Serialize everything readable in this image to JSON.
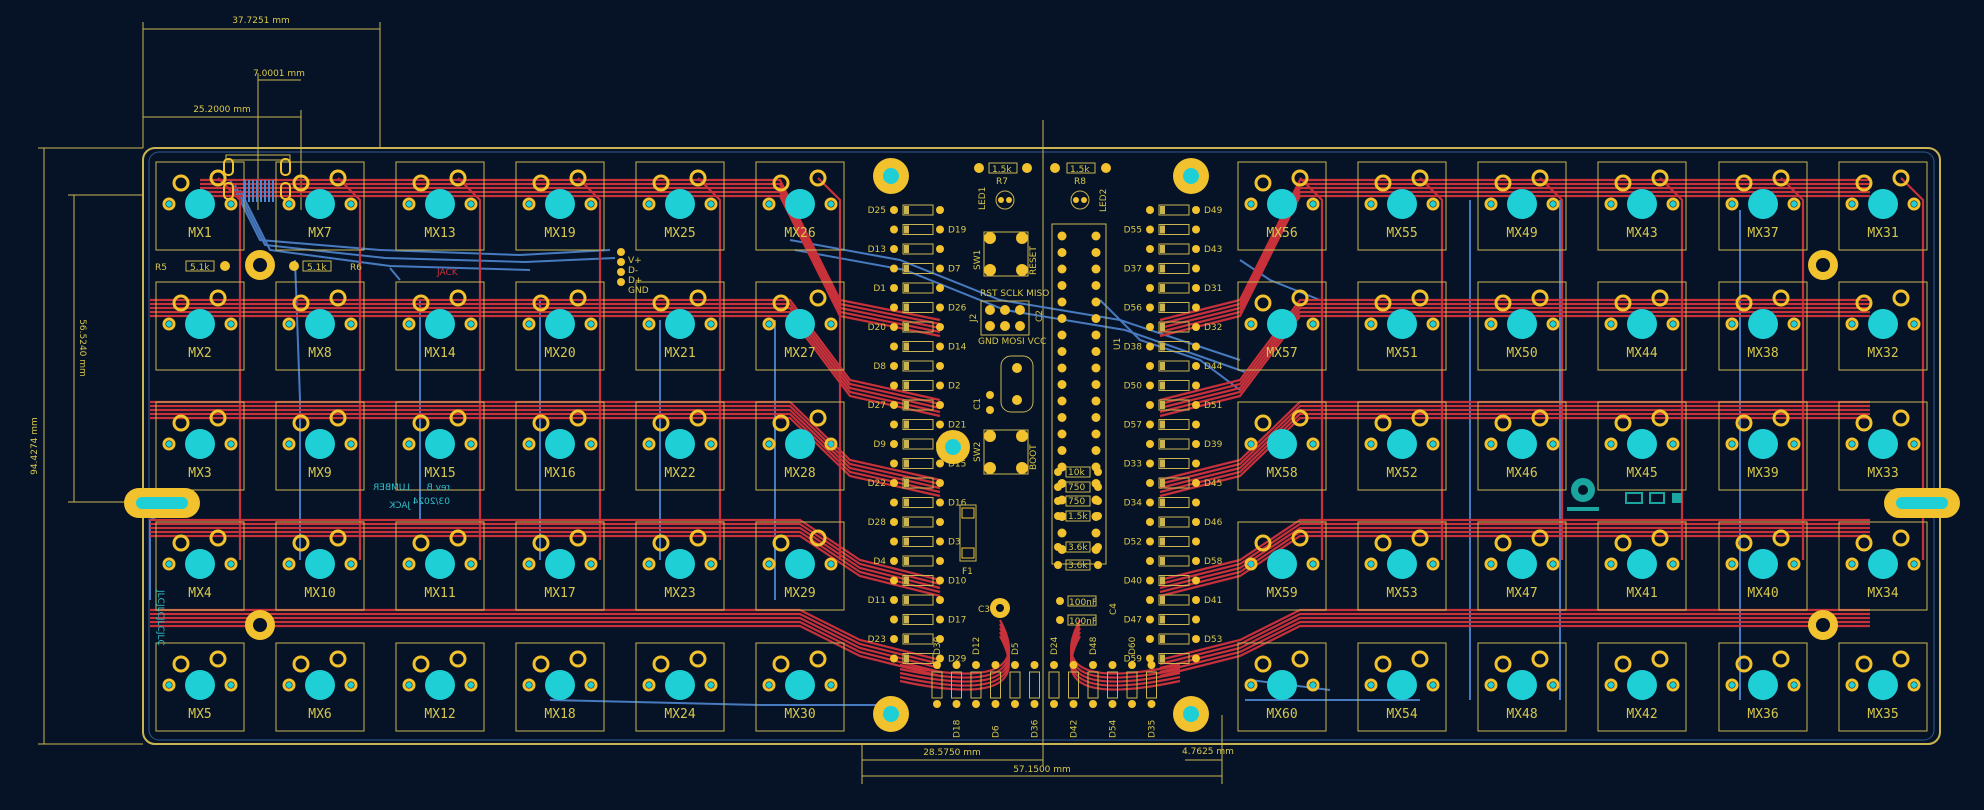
{
  "colors": {
    "background": "#061327",
    "outline": "#c9b451",
    "pad": "#f2c12e",
    "hole": "#1fcfd6",
    "trace_front": "#c8313a",
    "trace_back": "#4f86d0",
    "silk": "#2fc0c8"
  },
  "dimensions": {
    "top_overall": "37.7251 mm",
    "top_offset": "25.2000 mm",
    "top_small": "7.0001 mm",
    "left_inner": "56.5240 mm",
    "left_outer": "94.4274 mm",
    "bottom_a": "28.5750 mm",
    "bottom_b": "57.1500 mm",
    "bottom_c": "4.7625 mm"
  },
  "switch_grid": {
    "left": [
      [
        "MX1",
        "MX7",
        "MX13",
        "MX19",
        "MX25",
        "MX26"
      ],
      [
        "MX2",
        "MX8",
        "MX14",
        "MX20",
        "MX21",
        "MX27"
      ],
      [
        "MX3",
        "MX9",
        "MX15",
        "MX16",
        "MX22",
        "MX28"
      ],
      [
        "MX4",
        "MX10",
        "MX11",
        "MX17",
        "MX23",
        "MX29"
      ],
      [
        "MX5",
        "MX6",
        "MX12",
        "MX18",
        "MX24",
        "MX30"
      ]
    ],
    "right": [
      [
        "MX56",
        "MX55",
        "MX49",
        "MX43",
        "MX37",
        "MX31"
      ],
      [
        "MX57",
        "MX51",
        "MX50",
        "MX44",
        "MX38",
        "MX32"
      ],
      [
        "MX58",
        "MX52",
        "MX46",
        "MX45",
        "MX39",
        "MX33"
      ],
      [
        "MX59",
        "MX53",
        "MX47",
        "MX41",
        "MX40",
        "MX34"
      ],
      [
        "MX60",
        "MX54",
        "MX48",
        "MX42",
        "MX36",
        "MX35"
      ]
    ]
  },
  "diodes_left": [
    "D25",
    "D19",
    "D13",
    "D7",
    "D1",
    "D26",
    "D20",
    "D14",
    "D8",
    "D2",
    "D27",
    "D21",
    "D9",
    "D15",
    "D22",
    "D16",
    "D28",
    "D3",
    "D4",
    "D10",
    "D11",
    "D17",
    "D23",
    "D29"
  ],
  "diodes_right": [
    "D49",
    "D55",
    "D43",
    "D37",
    "D31",
    "D56",
    "D32",
    "D38",
    "D44",
    "D50",
    "D51",
    "D57",
    "D39",
    "D33",
    "D45",
    "D34",
    "D46",
    "D52",
    "D58",
    "D40",
    "D41",
    "D47",
    "D53",
    "D59"
  ],
  "diodes_bottom": [
    "D30",
    "D18",
    "D12",
    "D6",
    "D5",
    "D36",
    "D24",
    "D42",
    "D48",
    "D54",
    "D60",
    "D35"
  ],
  "components": {
    "r5": "R5",
    "r6": "R6",
    "r5_value": "5.1k",
    "r6_value": "5.1k",
    "r7": "R7",
    "r8": "R8",
    "r7_value": "1.5k",
    "r8_value": "1.5k",
    "led1": "LED1",
    "led2": "LED2",
    "sw1": "SW1",
    "sw2": "SW2",
    "j2": "J2",
    "c1": "C1",
    "c2": "C2",
    "c3": "C3",
    "c4": "C4",
    "f1": "F1",
    "u1": "U1",
    "reset": "RESET",
    "boot": "BOOT",
    "isp_top": "RST SCLK MISO",
    "isp_bottom": "GND MOSI VCC",
    "res_values": [
      "10k",
      "750",
      "750",
      "1.5k",
      "3.6k",
      "3.6k"
    ],
    "cap_values": [
      "100nF",
      "100nF"
    ],
    "usb_pins": [
      "V+",
      "D-",
      "D+",
      "GND"
    ]
  },
  "silk": {
    "logo_top": "JACK",
    "logo_bottom_main": "JACK",
    "logo_bottom_sub": "LUMBER",
    "rev": "rev B",
    "date": "03/2024",
    "side_text": "JLCJLCJLCJLC"
  }
}
